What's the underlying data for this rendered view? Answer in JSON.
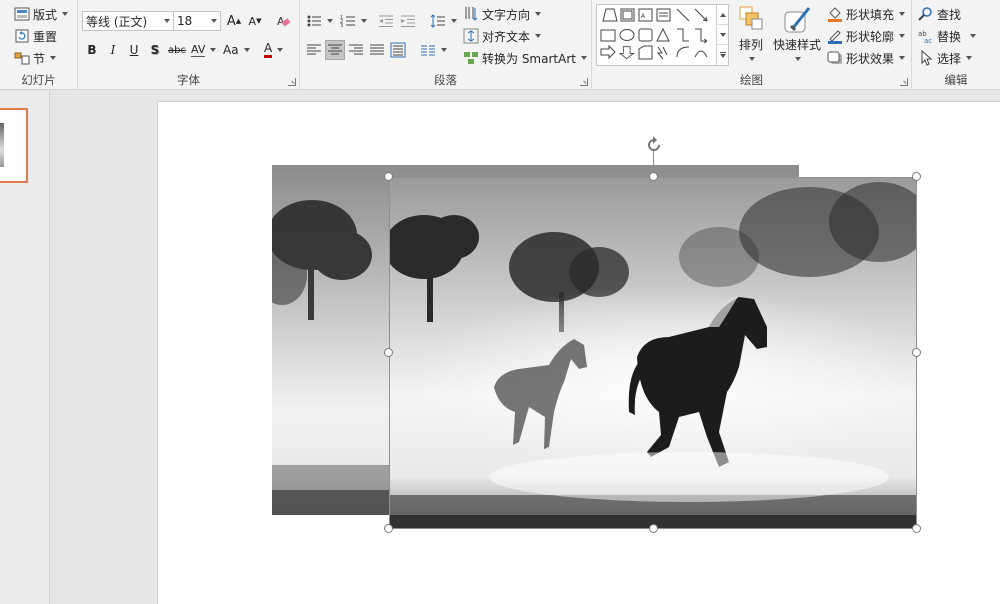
{
  "ribbon": {
    "slides_group": {
      "label": "幻灯片",
      "layout": "版式",
      "reset": "重置",
      "section": "节"
    },
    "font_group": {
      "label": "字体",
      "font_name": "等线 (正文)",
      "font_size": "18",
      "grow": "A",
      "shrink": "A",
      "bold": "B",
      "italic": "I",
      "underline": "U",
      "shadow": "S",
      "strike": "abc",
      "spacing": "AV",
      "case": "Aa",
      "color": "A"
    },
    "paragraph_group": {
      "label": "段落",
      "text_direction": "文字方向",
      "align_text": "对齐文本",
      "convert_smartart": "转换为 SmartArt"
    },
    "drawing_group": {
      "label": "绘图",
      "arrange": "排列",
      "quick_styles": "快速样式",
      "shape_fill": "形状填充",
      "shape_outline": "形状轮廓",
      "shape_effects": "形状效果"
    },
    "editing_group": {
      "label": "编辑",
      "find": "查找",
      "replace": "替换",
      "select": "选择"
    }
  },
  "colors": {
    "accent": "#e07a4f",
    "ribbon_bg": "#f3f3f3",
    "work_bg": "#e6e6e6"
  }
}
